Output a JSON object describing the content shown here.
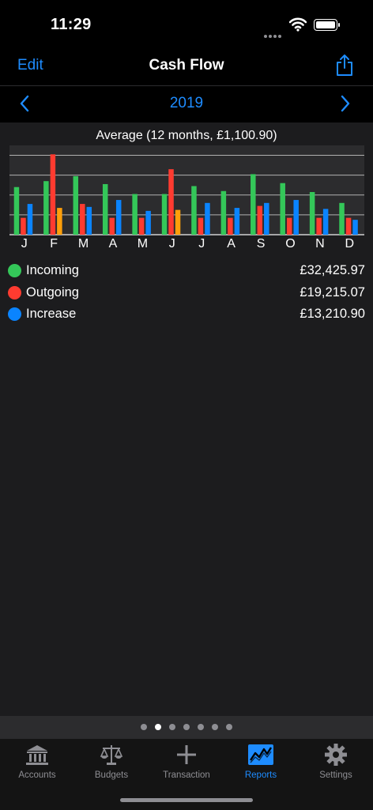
{
  "status_bar": {
    "time": "11:29"
  },
  "nav": {
    "edit_label": "Edit",
    "title": "Cash Flow",
    "share_icon": "share-icon"
  },
  "year_selector": {
    "year": "2019",
    "prev_icon": "chevron-left-icon",
    "next_icon": "chevron-right-icon"
  },
  "colors": {
    "accent": "#1e8cff",
    "incoming": "#34c759",
    "outgoing": "#ff3b30",
    "increase": "#0a84ff",
    "negative": "#ff9f0a"
  },
  "chart_data": {
    "type": "bar",
    "title": "Average (12 months, £1,100.90)",
    "categories": [
      "J",
      "F",
      "M",
      "A",
      "M",
      "J",
      "J",
      "A",
      "S",
      "O",
      "N",
      "D"
    ],
    "series": [
      {
        "name": "Incoming",
        "color": "#34c759",
        "values": [
          2400,
          2700,
          2950,
          2550,
          2050,
          2050,
          2450,
          2200,
          3050,
          2600,
          2150,
          1600
        ]
      },
      {
        "name": "Outgoing",
        "color": "#ff3b30",
        "values": [
          850,
          4050,
          1550,
          850,
          850,
          3300,
          850,
          850,
          1450,
          850,
          850,
          850
        ]
      },
      {
        "name": "Increase",
        "color": "#0a84ff",
        "values": [
          1550,
          -1350,
          1400,
          1750,
          1200,
          -1250,
          1600,
          1350,
          1600,
          1750,
          1300,
          750
        ]
      }
    ],
    "ylim": [
      0,
      4500
    ],
    "grid": true,
    "legend": "below"
  },
  "legend": [
    {
      "label": "Incoming",
      "value": "£32,425.97",
      "color": "#34c759"
    },
    {
      "label": "Outgoing",
      "value": "£19,215.07",
      "color": "#ff3b30"
    },
    {
      "label": "Increase",
      "value": "£13,210.90",
      "color": "#0a84ff"
    }
  ],
  "pager": {
    "count": 7,
    "active_index": 1
  },
  "tabs": [
    {
      "label": "Accounts",
      "icon": "bank-icon",
      "active": false
    },
    {
      "label": "Budgets",
      "icon": "scales-icon",
      "active": false
    },
    {
      "label": "Transaction",
      "icon": "plus-icon",
      "active": false
    },
    {
      "label": "Reports",
      "icon": "chart-icon",
      "active": true
    },
    {
      "label": "Settings",
      "icon": "gear-icon",
      "active": false
    }
  ]
}
